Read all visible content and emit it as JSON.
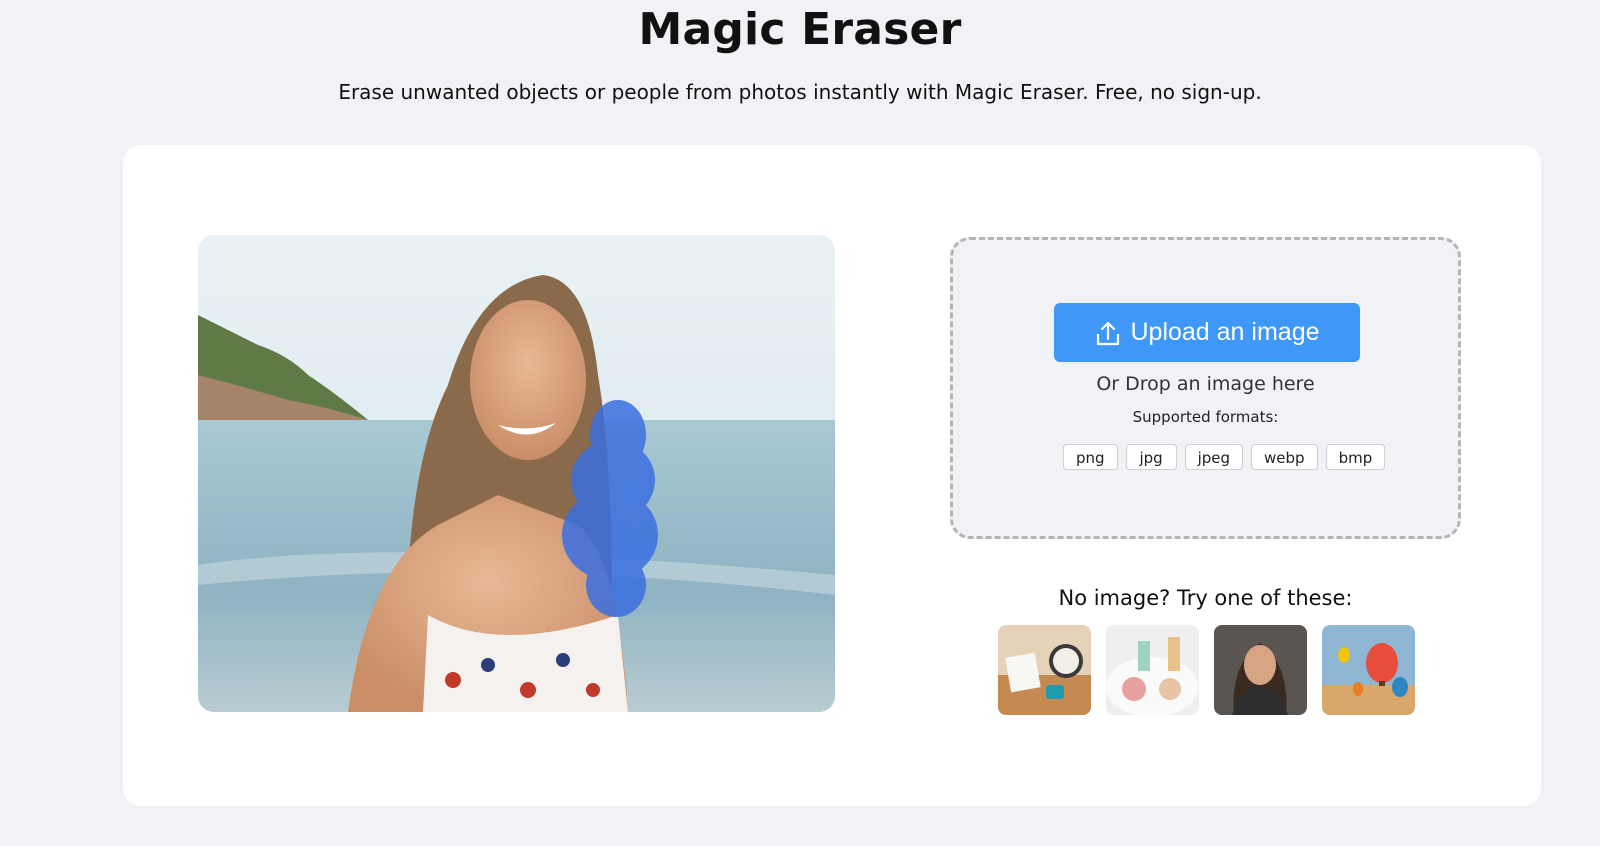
{
  "header": {
    "title": "Magic Eraser",
    "subtitle": "Erase unwanted objects or people from photos instantly with Magic Eraser. Free, no sign-up."
  },
  "hero_image": {
    "description_icon": "photo-woman-beach-with-blue-mask"
  },
  "upload": {
    "button_label": "Upload an image",
    "button_icon": "upload-icon",
    "drop_text": "Or Drop an image here",
    "formats_label": "Supported formats:",
    "formats": [
      "png",
      "jpg",
      "jpeg",
      "webp",
      "bmp"
    ]
  },
  "samples": {
    "title": "No image? Try one of these:",
    "items": [
      {
        "icon": "sample-desk-clock-thumbnail"
      },
      {
        "icon": "sample-cosmetics-thumbnail"
      },
      {
        "icon": "sample-woman-portrait-thumbnail"
      },
      {
        "icon": "sample-hot-air-balloons-thumbnail"
      }
    ]
  },
  "colors": {
    "page_bg": "#f1f2f5",
    "card_bg": "#ffffff",
    "accent": "#3f98f7",
    "mask": "#3b6fe0"
  }
}
